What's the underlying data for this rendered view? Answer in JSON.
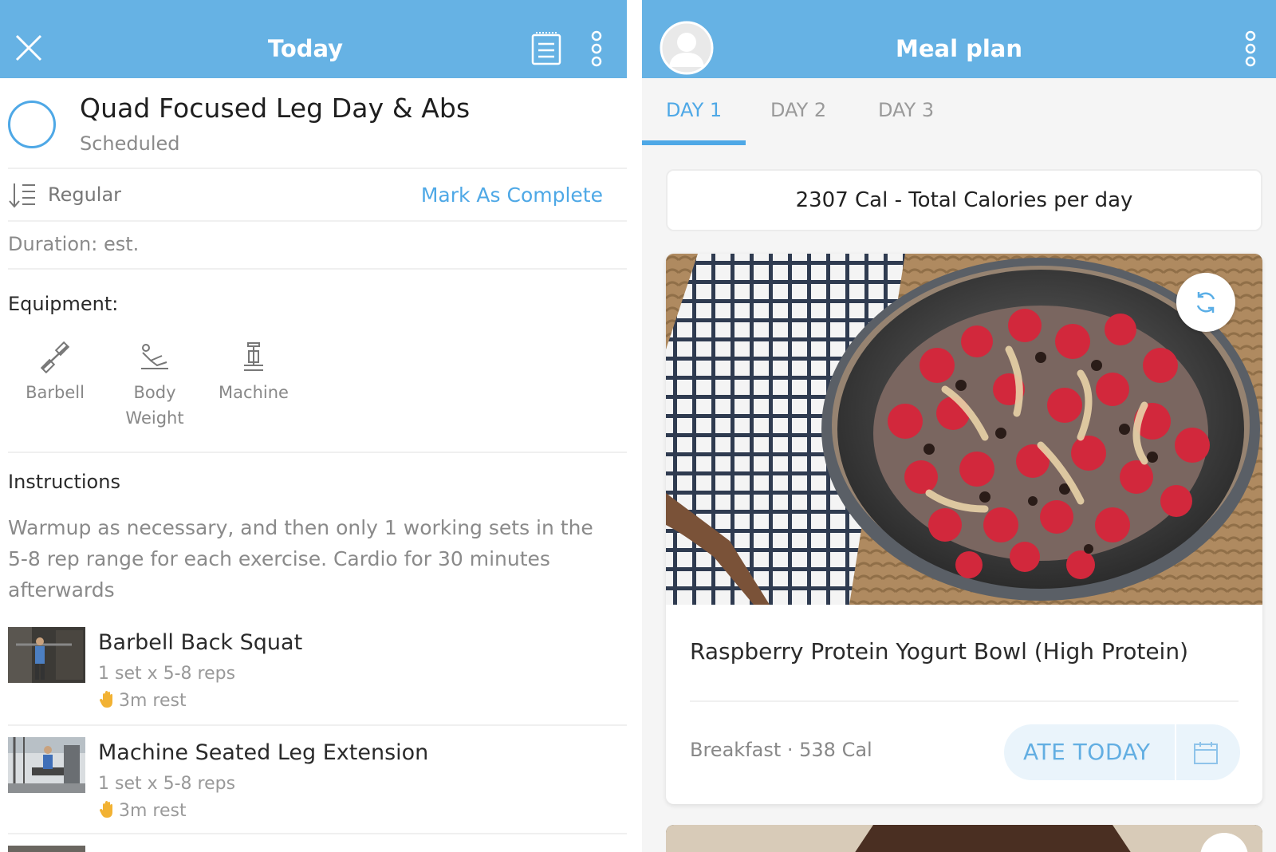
{
  "left": {
    "header": {
      "title": "Today",
      "close_icon": "close-icon",
      "notes_icon": "notes-icon",
      "more_icon": "more-vertical-icon"
    },
    "workout": {
      "title": "Quad Focused Leg Day & Abs",
      "status": "Scheduled"
    },
    "sort": {
      "label": "Regular",
      "icon": "sort-icon"
    },
    "mark_complete": "Mark As Complete",
    "duration": "Duration: est.",
    "equipment": {
      "heading": "Equipment:",
      "items": [
        {
          "label": "Barbell",
          "icon": "barbell-icon"
        },
        {
          "label": "Body Weight",
          "icon": "body-weight-icon"
        },
        {
          "label": "Machine",
          "icon": "machine-icon"
        }
      ]
    },
    "instructions": {
      "heading": "Instructions",
      "text": "Warmup as necessary, and then only 1 working sets in the 5-8 rep range for each exercise. Cardio for 30 minutes afterwards"
    },
    "exercises": [
      {
        "name": "Barbell Back Squat",
        "sets": "1 set x 5-8 reps",
        "rest": "3m rest"
      },
      {
        "name": "Machine Seated Leg Extension",
        "sets": "1 set x 5-8 reps",
        "rest": "3m rest"
      }
    ]
  },
  "right": {
    "header": {
      "title": "Meal plan",
      "avatar_icon": "avatar-icon",
      "more_icon": "more-vertical-icon"
    },
    "tabs": [
      {
        "label": "DAY 1",
        "active": true
      },
      {
        "label": "DAY 2",
        "active": false
      },
      {
        "label": "DAY 3",
        "active": false
      }
    ],
    "total_calories": "2307 Cal - Total Calories per day",
    "meal": {
      "name": "Raspberry Protein Yogurt Bowl (High Protein)",
      "meta": "Breakfast · 538 Cal",
      "ate_label": "ATE TODAY",
      "calendar_icon": "calendar-icon",
      "swap_icon": "refresh-icon"
    }
  },
  "colors": {
    "header": "#66b2e4",
    "accent": "#4ea8e6",
    "tab_background": "#f5f5f5"
  }
}
